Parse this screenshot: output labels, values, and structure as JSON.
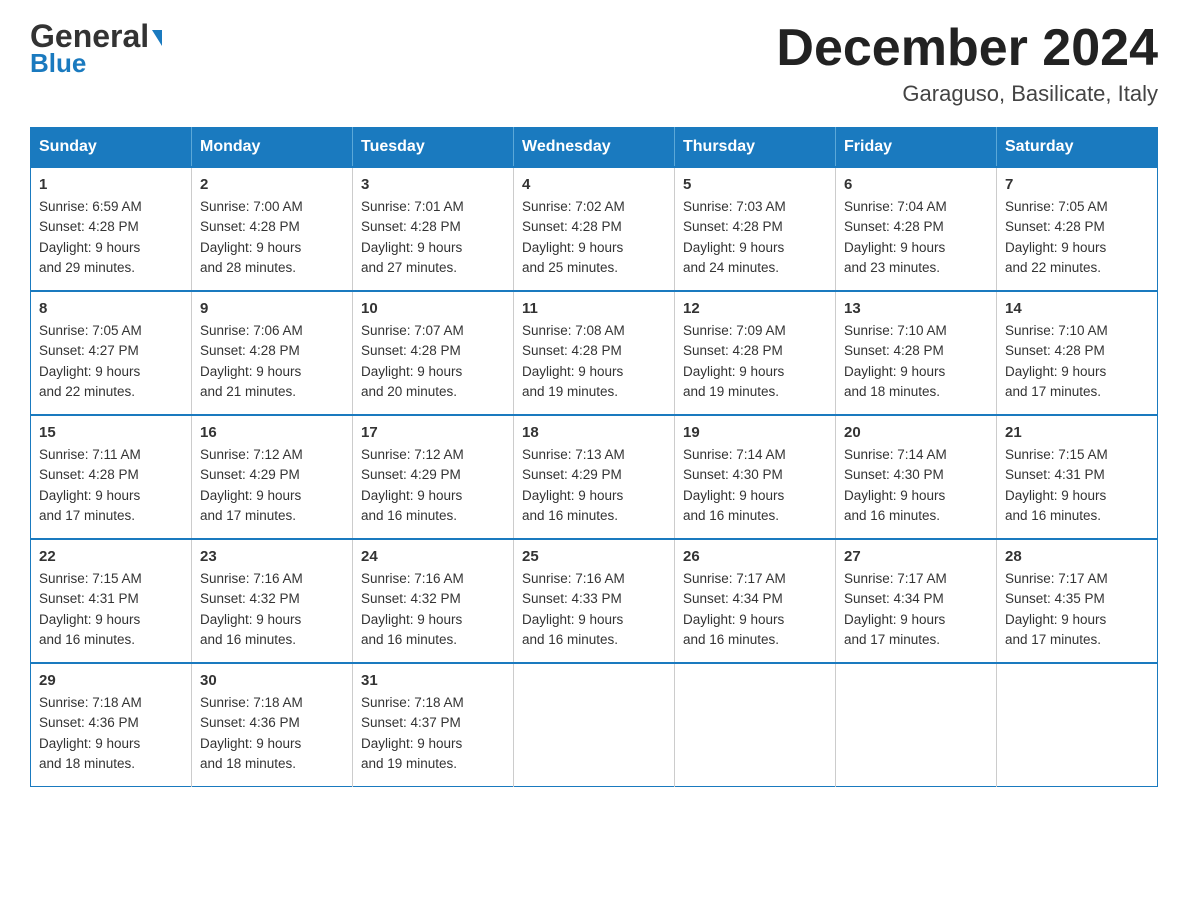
{
  "logo": {
    "general": "General",
    "blue": "Blue"
  },
  "header": {
    "month": "December 2024",
    "location": "Garaguso, Basilicate, Italy"
  },
  "days_of_week": [
    "Sunday",
    "Monday",
    "Tuesday",
    "Wednesday",
    "Thursday",
    "Friday",
    "Saturday"
  ],
  "weeks": [
    [
      {
        "day": "1",
        "sunrise": "6:59 AM",
        "sunset": "4:28 PM",
        "daylight": "9 hours and 29 minutes."
      },
      {
        "day": "2",
        "sunrise": "7:00 AM",
        "sunset": "4:28 PM",
        "daylight": "9 hours and 28 minutes."
      },
      {
        "day": "3",
        "sunrise": "7:01 AM",
        "sunset": "4:28 PM",
        "daylight": "9 hours and 27 minutes."
      },
      {
        "day": "4",
        "sunrise": "7:02 AM",
        "sunset": "4:28 PM",
        "daylight": "9 hours and 25 minutes."
      },
      {
        "day": "5",
        "sunrise": "7:03 AM",
        "sunset": "4:28 PM",
        "daylight": "9 hours and 24 minutes."
      },
      {
        "day": "6",
        "sunrise": "7:04 AM",
        "sunset": "4:28 PM",
        "daylight": "9 hours and 23 minutes."
      },
      {
        "day": "7",
        "sunrise": "7:05 AM",
        "sunset": "4:28 PM",
        "daylight": "9 hours and 22 minutes."
      }
    ],
    [
      {
        "day": "8",
        "sunrise": "7:05 AM",
        "sunset": "4:27 PM",
        "daylight": "9 hours and 22 minutes."
      },
      {
        "day": "9",
        "sunrise": "7:06 AM",
        "sunset": "4:28 PM",
        "daylight": "9 hours and 21 minutes."
      },
      {
        "day": "10",
        "sunrise": "7:07 AM",
        "sunset": "4:28 PM",
        "daylight": "9 hours and 20 minutes."
      },
      {
        "day": "11",
        "sunrise": "7:08 AM",
        "sunset": "4:28 PM",
        "daylight": "9 hours and 19 minutes."
      },
      {
        "day": "12",
        "sunrise": "7:09 AM",
        "sunset": "4:28 PM",
        "daylight": "9 hours and 19 minutes."
      },
      {
        "day": "13",
        "sunrise": "7:10 AM",
        "sunset": "4:28 PM",
        "daylight": "9 hours and 18 minutes."
      },
      {
        "day": "14",
        "sunrise": "7:10 AM",
        "sunset": "4:28 PM",
        "daylight": "9 hours and 17 minutes."
      }
    ],
    [
      {
        "day": "15",
        "sunrise": "7:11 AM",
        "sunset": "4:28 PM",
        "daylight": "9 hours and 17 minutes."
      },
      {
        "day": "16",
        "sunrise": "7:12 AM",
        "sunset": "4:29 PM",
        "daylight": "9 hours and 17 minutes."
      },
      {
        "day": "17",
        "sunrise": "7:12 AM",
        "sunset": "4:29 PM",
        "daylight": "9 hours and 16 minutes."
      },
      {
        "day": "18",
        "sunrise": "7:13 AM",
        "sunset": "4:29 PM",
        "daylight": "9 hours and 16 minutes."
      },
      {
        "day": "19",
        "sunrise": "7:14 AM",
        "sunset": "4:30 PM",
        "daylight": "9 hours and 16 minutes."
      },
      {
        "day": "20",
        "sunrise": "7:14 AM",
        "sunset": "4:30 PM",
        "daylight": "9 hours and 16 minutes."
      },
      {
        "day": "21",
        "sunrise": "7:15 AM",
        "sunset": "4:31 PM",
        "daylight": "9 hours and 16 minutes."
      }
    ],
    [
      {
        "day": "22",
        "sunrise": "7:15 AM",
        "sunset": "4:31 PM",
        "daylight": "9 hours and 16 minutes."
      },
      {
        "day": "23",
        "sunrise": "7:16 AM",
        "sunset": "4:32 PM",
        "daylight": "9 hours and 16 minutes."
      },
      {
        "day": "24",
        "sunrise": "7:16 AM",
        "sunset": "4:32 PM",
        "daylight": "9 hours and 16 minutes."
      },
      {
        "day": "25",
        "sunrise": "7:16 AM",
        "sunset": "4:33 PM",
        "daylight": "9 hours and 16 minutes."
      },
      {
        "day": "26",
        "sunrise": "7:17 AM",
        "sunset": "4:34 PM",
        "daylight": "9 hours and 16 minutes."
      },
      {
        "day": "27",
        "sunrise": "7:17 AM",
        "sunset": "4:34 PM",
        "daylight": "9 hours and 17 minutes."
      },
      {
        "day": "28",
        "sunrise": "7:17 AM",
        "sunset": "4:35 PM",
        "daylight": "9 hours and 17 minutes."
      }
    ],
    [
      {
        "day": "29",
        "sunrise": "7:18 AM",
        "sunset": "4:36 PM",
        "daylight": "9 hours and 18 minutes."
      },
      {
        "day": "30",
        "sunrise": "7:18 AM",
        "sunset": "4:36 PM",
        "daylight": "9 hours and 18 minutes."
      },
      {
        "day": "31",
        "sunrise": "7:18 AM",
        "sunset": "4:37 PM",
        "daylight": "9 hours and 19 minutes."
      },
      null,
      null,
      null,
      null
    ]
  ],
  "labels": {
    "sunrise": "Sunrise:",
    "sunset": "Sunset:",
    "daylight": "Daylight:"
  }
}
